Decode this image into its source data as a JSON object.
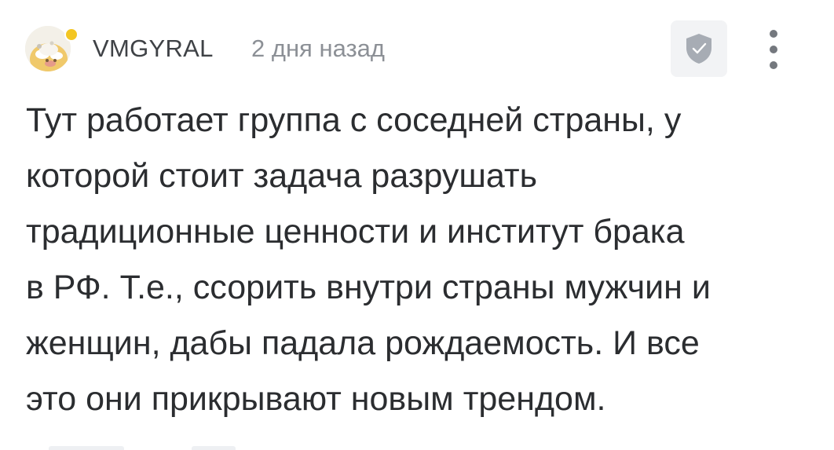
{
  "comment": {
    "author": {
      "username": "VMGYRAL",
      "avatar_icon": "illustrated-face-avatar-icon",
      "status_color": "#f3c623"
    },
    "timestamp": "2 дня назад",
    "actions": {
      "verified_icon": "shield-check-icon",
      "more_icon": "more-vertical-icon"
    },
    "body_lines": [
      "Тут работает группа с соседней страны, у",
      "которой стоит задача разрушать",
      "традиционные ценности и институт брака",
      "в РФ. Т.е., ссорить внутри страны мужчин и",
      "женщин, дабы падала рождаемость. И все",
      "это они прикрывают новым трендом."
    ]
  }
}
